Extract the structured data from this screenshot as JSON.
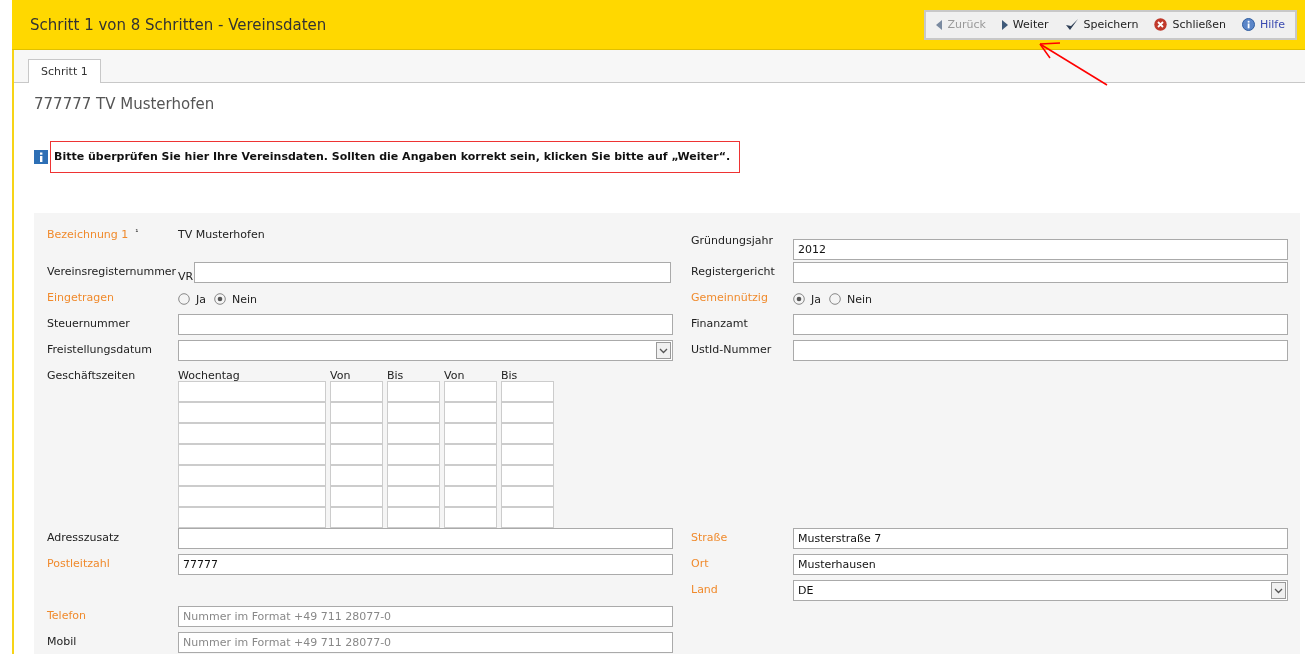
{
  "header": {
    "title": "Schritt 1 von 8 Schritten - Vereinsdaten"
  },
  "toolbar": [
    {
      "kind": "back",
      "label": "Zurück",
      "disabled": true
    },
    {
      "kind": "next",
      "label": "Weiter",
      "disabled": false
    },
    {
      "kind": "save",
      "label": "Speichern",
      "disabled": false
    },
    {
      "kind": "close",
      "label": "Schließen",
      "disabled": false
    },
    {
      "kind": "help",
      "label": "Hilfe",
      "disabled": false
    }
  ],
  "tabs": [
    {
      "label": "Schritt 1",
      "selected": true
    }
  ],
  "heading": "777777 TV Musterhofen",
  "info_message": "Bitte überprüfen Sie hier Ihre Vereinsdaten. Sollten die Angaben korrekt sein, klicken Sie bitte auf „Weiter“.",
  "form_rows": [
    {
      "left": {
        "kind": "text",
        "label": "Bezeichnung 1",
        "note": "¹",
        "required": true,
        "value": "TV Musterhofen"
      },
      "right": {
        "kind": "input",
        "label": "Gründungsjahr",
        "required": false,
        "value": "2012"
      }
    },
    {
      "left": {
        "kind": "input",
        "label": "Vereinsregisternummer",
        "required": false,
        "prefix": "VR"
      },
      "right": {
        "kind": "input",
        "label": "Registergericht",
        "required": false
      }
    },
    {
      "left": {
        "kind": "radio",
        "label": "Eingetragen",
        "required": true,
        "options": [
          {
            "label": "Ja",
            "selected": false
          },
          {
            "label": "Nein",
            "selected": true
          }
        ]
      },
      "right": {
        "kind": "radio",
        "label": "Gemeinnützig",
        "required": true,
        "options": [
          {
            "label": "Ja",
            "selected": true
          },
          {
            "label": "Nein",
            "selected": false
          }
        ]
      }
    },
    {
      "left": {
        "kind": "input",
        "label": "Steuernummer",
        "required": false
      },
      "right": {
        "kind": "input",
        "label": "Finanzamt",
        "required": false
      }
    },
    {
      "left": {
        "kind": "select",
        "label": "Freistellungsdatum",
        "required": false
      },
      "right": {
        "kind": "input",
        "label": "UstId-Nummer",
        "required": false
      }
    },
    {
      "left": {
        "kind": "hours",
        "label": "Geschäftszeiten",
        "required": false,
        "columns": [
          "Wochentag",
          "Von",
          "Bis",
          "Von",
          "Bis"
        ]
      }
    },
    {
      "left": {
        "kind": "input",
        "label": "Adresszusatz",
        "required": false
      },
      "right": {
        "kind": "input",
        "label": "Straße",
        "required": true,
        "value": "Musterstraße 7"
      }
    },
    {
      "left": {
        "kind": "input",
        "label": "Postleitzahl",
        "required": true,
        "value": "77777"
      },
      "right": {
        "kind": "input",
        "label": "Ort",
        "required": true,
        "value": "Musterhausen"
      }
    },
    {
      "right": {
        "kind": "select",
        "label": "Land",
        "required": true,
        "value": "DE"
      }
    },
    {
      "left": {
        "kind": "input",
        "label": "Telefon",
        "required": true,
        "placeholder": "Nummer im Format +49 711 28077-0"
      }
    },
    {
      "left": {
        "kind": "input",
        "label": "Mobil",
        "required": false,
        "placeholder": "Nummer im Format +49 711 28077-0"
      }
    }
  ]
}
